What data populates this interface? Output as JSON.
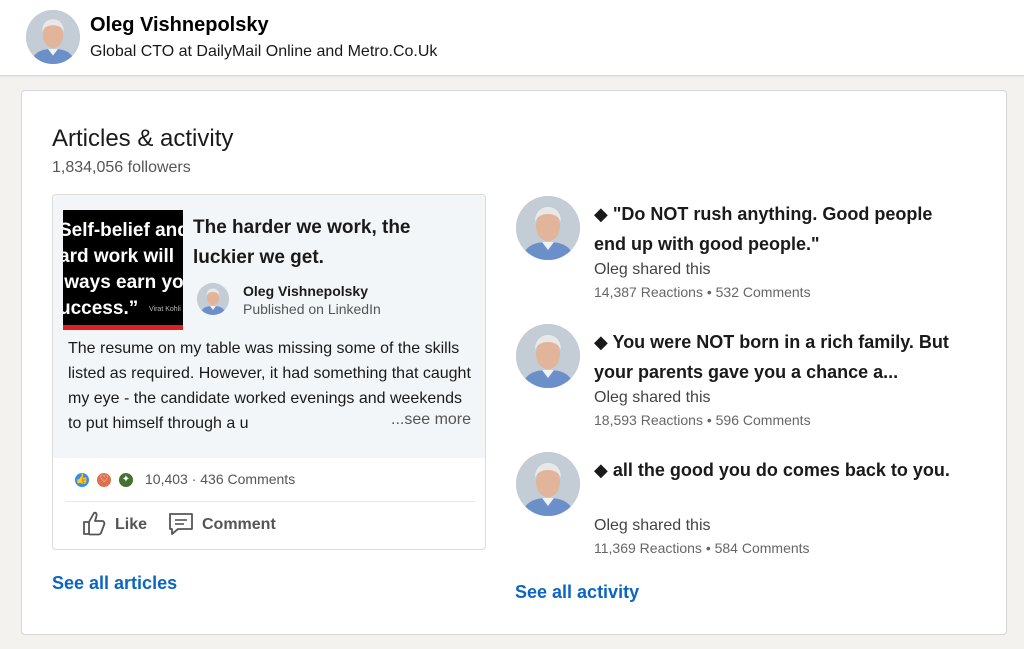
{
  "header": {
    "name": "Oleg Vishnepolsky",
    "headline": "Global CTO at DailyMail Online and Metro.Co.Uk"
  },
  "section": {
    "title": "Articles & activity",
    "followers": "1,834,056 followers"
  },
  "article": {
    "thumbnail_lines": [
      "Self-belief and",
      "ard work will",
      "lways earn yo",
      "uccess.”"
    ],
    "thumbnail_attribution": "Virat Kohli",
    "title": "The harder we work, the luckier we get.",
    "author": "Oleg Vishnepolsky",
    "published": "Published on LinkedIn",
    "excerpt": "The resume on my table was missing some of the skills listed as required. However, it had something that caught my eye - the candidate worked evenings and weekends to put himself through a u",
    "see_more": "...see more",
    "reactions": "10,403",
    "comments": "· 436 Comments",
    "like_label": "Like",
    "comment_label": "Comment"
  },
  "links": {
    "see_all_articles": "See all articles",
    "see_all_activity": "See all activity"
  },
  "activity": [
    {
      "title": "◆ \"Do NOT rush anything. Good people end up with good people.\"",
      "shared": "Oleg shared this",
      "stats": "14,387 Reactions • 532 Comments"
    },
    {
      "title": "◆ You were NOT born in a rich family. But your parents gave you a chance a...",
      "shared": "Oleg shared this",
      "stats": "18,593 Reactions • 596 Comments"
    },
    {
      "title": "◆ all the good you do comes back to you.",
      "shared": "Oleg shared this",
      "stats": "11,369 Reactions • 584 Comments"
    }
  ],
  "colors": {
    "link": "#0a66c2",
    "page_bg": "#f3f2ef",
    "like_reaction": "#378fe9",
    "love_reaction": "#df704d",
    "celebrate_reaction": "#44712e"
  }
}
